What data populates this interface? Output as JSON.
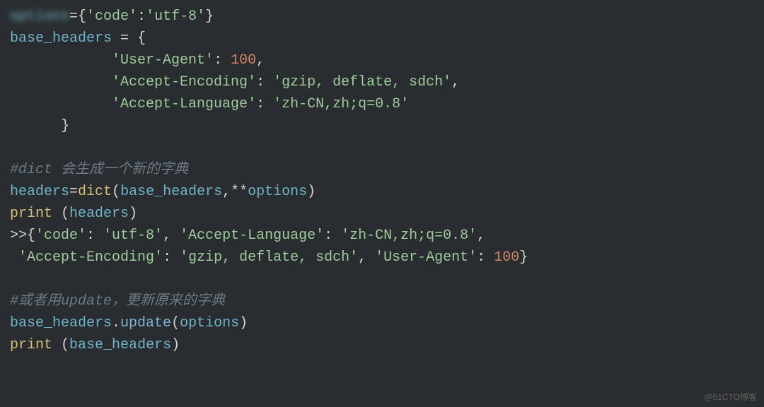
{
  "code": {
    "line1": {
      "blurred_var": "options",
      "assign": "={",
      "key1": "'code'",
      "colon": ":",
      "val1": "'utf-8'",
      "close": "}"
    },
    "line2": {
      "var": "base_headers",
      "assign": " = {"
    },
    "line3": {
      "indent": "            ",
      "key": "'User-Agent'",
      "colon": ": ",
      "val": "100",
      "comma": ","
    },
    "line4": {
      "indent": "            ",
      "key": "'Accept-Encoding'",
      "colon": ": ",
      "val": "'gzip, deflate, sdch'",
      "comma": ","
    },
    "line5": {
      "indent": "            ",
      "key": "'Accept-Language'",
      "colon": ": ",
      "val": "'zh-CN,zh;q=0.8'"
    },
    "line6": {
      "indent": "      ",
      "close": "}"
    },
    "blank1": " ",
    "line8": {
      "comment": "#dict 会生成一个新的字典"
    },
    "line9": {
      "var": "headers",
      "eq": "=",
      "func": "dict",
      "open": "(",
      "arg1": "base_headers",
      "comma": ",",
      "stars": "**",
      "arg2": "options",
      "close": ")"
    },
    "line10": {
      "print": "print",
      "space": " ",
      "open": "(",
      "arg": "headers",
      "close": ")"
    },
    "line11": {
      "prompt": ">>{",
      "k1": "'code'",
      "c1": ": ",
      "v1": "'utf-8'",
      "s1": ", ",
      "k2": "'Accept-Language'",
      "c2": ": ",
      "v2": "'zh-CN,zh;q=0.8'",
      "s2": ","
    },
    "line12": {
      "lead": " ",
      "k1": "'Accept-Encoding'",
      "c1": ": ",
      "v1": "'gzip, deflate, sdch'",
      "s1": ", ",
      "k2": "'User-Agent'",
      "c2": ": ",
      "v2": "100",
      "close": "}"
    },
    "blank2": " ",
    "line14": {
      "comment": "#或者用update，更新原来的字典"
    },
    "line15": {
      "var": "base_headers",
      "dot": ".",
      "method": "update",
      "open": "(",
      "arg": "options",
      "close": ")"
    },
    "line16": {
      "print": "print",
      "space": " ",
      "open": "(",
      "arg": "base_headers",
      "close": ")"
    }
  },
  "watermark": "@51CTO博客"
}
